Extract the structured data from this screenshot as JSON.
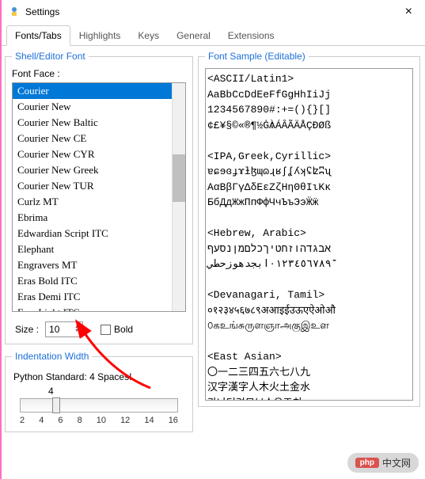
{
  "window": {
    "title": "Settings",
    "close": "×"
  },
  "tabs": {
    "fonts": "Fonts/Tabs",
    "highlights": "Highlights",
    "keys": "Keys",
    "general": "General",
    "extensions": "Extensions"
  },
  "shellfont": {
    "legend": "Shell/Editor Font",
    "fontface_label": "Font Face :",
    "fonts": [
      "Courier",
      "Courier New",
      "Courier New Baltic",
      "Courier New CE",
      "Courier New CYR",
      "Courier New Greek",
      "Courier New TUR",
      "Curlz MT",
      "Ebrima",
      "Edwardian Script ITC",
      "Elephant",
      "Engravers MT",
      "Eras Bold ITC",
      "Eras Demi ITC",
      "Eras Light ITC"
    ],
    "selected": "Courier",
    "size_label": "Size :",
    "size_value": "10",
    "bold_label": "Bold"
  },
  "indentation": {
    "legend": "Indentation Width",
    "label": "Python Standard: 4 Spaces!",
    "value": "4",
    "ticks": [
      "2",
      "4",
      "6",
      "8",
      "10",
      "12",
      "14",
      "16"
    ]
  },
  "sample": {
    "legend": "Font Sample (Editable)",
    "text": "<ASCII/Latin1>\nAaBbCcDdEeFfGgHhIiJj\n1234567890#:+=(){}[]\n¢£¥§©«®¶½Ġ׃ÀÁÂÃÄÅÇÐØß\n\n<IPA,Greek,Cyrillic>\nɐɕɘɞɟɤɫɮɰɷɻʁʃʆʎʞʢʫʭʯ\nΑαΒβΓγΔδΕεΖζΗηΘθΙιΚκ\nБбДдЖжПпФфЧчЪъЭэӜӝ\n\n<Hebrew, Arabic>\nאבגדהוזחטיךכלםמןנסעף\n־٠١٢٣٤٥٦٧٨٩ابجدهوزحطي\n\n<Devanagari, Tamil>\n०१२३४५६७८९अआइईउऊएऐओऔ\n௦கஉங்சுருளஞாஅகுஇஉள\n\n<East Asian>\n〇一二三四五六七八九\n汉字漢字人木火土金水\n가냐더려모뵤수유즈치\nあいうえおアイウエオ"
  },
  "watermark": {
    "badge": "php",
    "text": "中文网"
  }
}
